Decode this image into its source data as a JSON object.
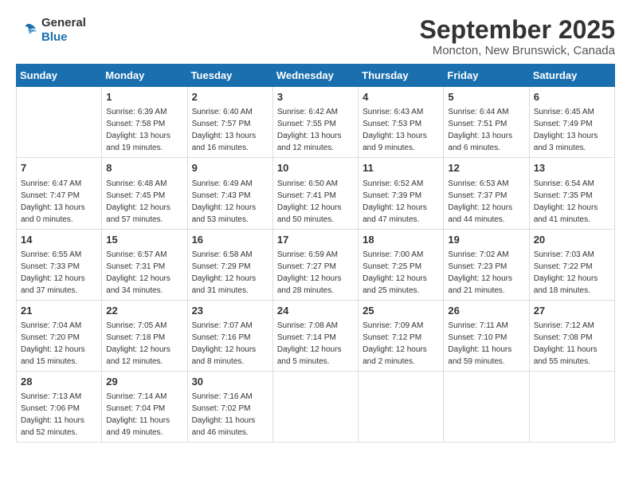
{
  "logo": {
    "general": "General",
    "blue": "Blue"
  },
  "header": {
    "month": "September 2025",
    "location": "Moncton, New Brunswick, Canada"
  },
  "days_of_week": [
    "Sunday",
    "Monday",
    "Tuesday",
    "Wednesday",
    "Thursday",
    "Friday",
    "Saturday"
  ],
  "weeks": [
    [
      {
        "day": "",
        "sunrise": "",
        "sunset": "",
        "daylight": ""
      },
      {
        "day": "1",
        "sunrise": "Sunrise: 6:39 AM",
        "sunset": "Sunset: 7:58 PM",
        "daylight": "Daylight: 13 hours and 19 minutes."
      },
      {
        "day": "2",
        "sunrise": "Sunrise: 6:40 AM",
        "sunset": "Sunset: 7:57 PM",
        "daylight": "Daylight: 13 hours and 16 minutes."
      },
      {
        "day": "3",
        "sunrise": "Sunrise: 6:42 AM",
        "sunset": "Sunset: 7:55 PM",
        "daylight": "Daylight: 13 hours and 12 minutes."
      },
      {
        "day": "4",
        "sunrise": "Sunrise: 6:43 AM",
        "sunset": "Sunset: 7:53 PM",
        "daylight": "Daylight: 13 hours and 9 minutes."
      },
      {
        "day": "5",
        "sunrise": "Sunrise: 6:44 AM",
        "sunset": "Sunset: 7:51 PM",
        "daylight": "Daylight: 13 hours and 6 minutes."
      },
      {
        "day": "6",
        "sunrise": "Sunrise: 6:45 AM",
        "sunset": "Sunset: 7:49 PM",
        "daylight": "Daylight: 13 hours and 3 minutes."
      }
    ],
    [
      {
        "day": "7",
        "sunrise": "Sunrise: 6:47 AM",
        "sunset": "Sunset: 7:47 PM",
        "daylight": "Daylight: 13 hours and 0 minutes."
      },
      {
        "day": "8",
        "sunrise": "Sunrise: 6:48 AM",
        "sunset": "Sunset: 7:45 PM",
        "daylight": "Daylight: 12 hours and 57 minutes."
      },
      {
        "day": "9",
        "sunrise": "Sunrise: 6:49 AM",
        "sunset": "Sunset: 7:43 PM",
        "daylight": "Daylight: 12 hours and 53 minutes."
      },
      {
        "day": "10",
        "sunrise": "Sunrise: 6:50 AM",
        "sunset": "Sunset: 7:41 PM",
        "daylight": "Daylight: 12 hours and 50 minutes."
      },
      {
        "day": "11",
        "sunrise": "Sunrise: 6:52 AM",
        "sunset": "Sunset: 7:39 PM",
        "daylight": "Daylight: 12 hours and 47 minutes."
      },
      {
        "day": "12",
        "sunrise": "Sunrise: 6:53 AM",
        "sunset": "Sunset: 7:37 PM",
        "daylight": "Daylight: 12 hours and 44 minutes."
      },
      {
        "day": "13",
        "sunrise": "Sunrise: 6:54 AM",
        "sunset": "Sunset: 7:35 PM",
        "daylight": "Daylight: 12 hours and 41 minutes."
      }
    ],
    [
      {
        "day": "14",
        "sunrise": "Sunrise: 6:55 AM",
        "sunset": "Sunset: 7:33 PM",
        "daylight": "Daylight: 12 hours and 37 minutes."
      },
      {
        "day": "15",
        "sunrise": "Sunrise: 6:57 AM",
        "sunset": "Sunset: 7:31 PM",
        "daylight": "Daylight: 12 hours and 34 minutes."
      },
      {
        "day": "16",
        "sunrise": "Sunrise: 6:58 AM",
        "sunset": "Sunset: 7:29 PM",
        "daylight": "Daylight: 12 hours and 31 minutes."
      },
      {
        "day": "17",
        "sunrise": "Sunrise: 6:59 AM",
        "sunset": "Sunset: 7:27 PM",
        "daylight": "Daylight: 12 hours and 28 minutes."
      },
      {
        "day": "18",
        "sunrise": "Sunrise: 7:00 AM",
        "sunset": "Sunset: 7:25 PM",
        "daylight": "Daylight: 12 hours and 25 minutes."
      },
      {
        "day": "19",
        "sunrise": "Sunrise: 7:02 AM",
        "sunset": "Sunset: 7:23 PM",
        "daylight": "Daylight: 12 hours and 21 minutes."
      },
      {
        "day": "20",
        "sunrise": "Sunrise: 7:03 AM",
        "sunset": "Sunset: 7:22 PM",
        "daylight": "Daylight: 12 hours and 18 minutes."
      }
    ],
    [
      {
        "day": "21",
        "sunrise": "Sunrise: 7:04 AM",
        "sunset": "Sunset: 7:20 PM",
        "daylight": "Daylight: 12 hours and 15 minutes."
      },
      {
        "day": "22",
        "sunrise": "Sunrise: 7:05 AM",
        "sunset": "Sunset: 7:18 PM",
        "daylight": "Daylight: 12 hours and 12 minutes."
      },
      {
        "day": "23",
        "sunrise": "Sunrise: 7:07 AM",
        "sunset": "Sunset: 7:16 PM",
        "daylight": "Daylight: 12 hours and 8 minutes."
      },
      {
        "day": "24",
        "sunrise": "Sunrise: 7:08 AM",
        "sunset": "Sunset: 7:14 PM",
        "daylight": "Daylight: 12 hours and 5 minutes."
      },
      {
        "day": "25",
        "sunrise": "Sunrise: 7:09 AM",
        "sunset": "Sunset: 7:12 PM",
        "daylight": "Daylight: 12 hours and 2 minutes."
      },
      {
        "day": "26",
        "sunrise": "Sunrise: 7:11 AM",
        "sunset": "Sunset: 7:10 PM",
        "daylight": "Daylight: 11 hours and 59 minutes."
      },
      {
        "day": "27",
        "sunrise": "Sunrise: 7:12 AM",
        "sunset": "Sunset: 7:08 PM",
        "daylight": "Daylight: 11 hours and 55 minutes."
      }
    ],
    [
      {
        "day": "28",
        "sunrise": "Sunrise: 7:13 AM",
        "sunset": "Sunset: 7:06 PM",
        "daylight": "Daylight: 11 hours and 52 minutes."
      },
      {
        "day": "29",
        "sunrise": "Sunrise: 7:14 AM",
        "sunset": "Sunset: 7:04 PM",
        "daylight": "Daylight: 11 hours and 49 minutes."
      },
      {
        "day": "30",
        "sunrise": "Sunrise: 7:16 AM",
        "sunset": "Sunset: 7:02 PM",
        "daylight": "Daylight: 11 hours and 46 minutes."
      },
      {
        "day": "",
        "sunrise": "",
        "sunset": "",
        "daylight": ""
      },
      {
        "day": "",
        "sunrise": "",
        "sunset": "",
        "daylight": ""
      },
      {
        "day": "",
        "sunrise": "",
        "sunset": "",
        "daylight": ""
      },
      {
        "day": "",
        "sunrise": "",
        "sunset": "",
        "daylight": ""
      }
    ]
  ]
}
